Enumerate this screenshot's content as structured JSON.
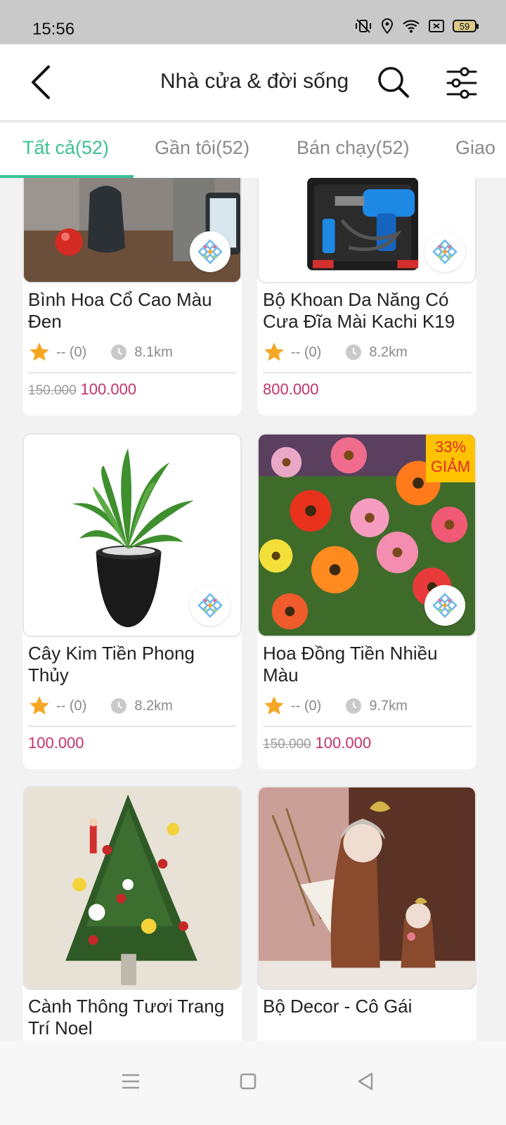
{
  "status": {
    "time": "15:56",
    "battery": "59"
  },
  "header": {
    "title": "Nhà cửa & đời sống"
  },
  "tabs": [
    {
      "label": "Tất cả(52)"
    },
    {
      "label": "Gần tôi(52)"
    },
    {
      "label": "Bán chạy(52)"
    },
    {
      "label": "Giao"
    }
  ],
  "products": [
    {
      "title": "Bình Hoa Cổ Cao Màu Đen",
      "rating": "-- (0)",
      "distance": "8.1km",
      "old_price": "150.000",
      "price": "100.000"
    },
    {
      "title": "Bộ Khoan Da Năng Có Cưa Đĩa Mài Kachi K19",
      "rating": "-- (0)",
      "distance": "8.2km",
      "old_price": "",
      "price": "800.000"
    },
    {
      "title": "Cây Kim Tiền Phong Thủy",
      "rating": "-- (0)",
      "distance": "8.2km",
      "old_price": "",
      "price": "100.000"
    },
    {
      "title": "Hoa Đồng Tiền Nhiều Màu",
      "rating": "-- (0)",
      "distance": "9.7km",
      "old_price": "150.000",
      "price": "100.000",
      "discount": "33%",
      "discount_label": "GIẢM"
    },
    {
      "title": "Cành Thông Tươi Trang Trí Noel"
    },
    {
      "title": "Bộ Decor - Cô Gái"
    }
  ],
  "colors": {
    "accent": "#3dbf96",
    "price": "#c2336b",
    "star": "#f5a623",
    "badge": "#ffc300"
  }
}
